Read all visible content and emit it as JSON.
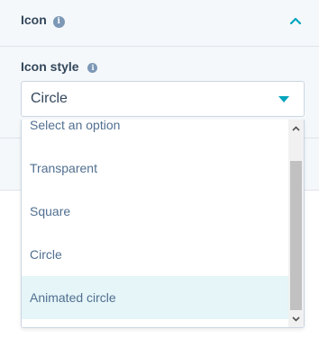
{
  "section": {
    "title": "Icon",
    "info_glyph": "i",
    "collapse_icon": "chevron-up-icon"
  },
  "field": {
    "label": "Icon style",
    "info_glyph": "i",
    "selected_value": "Circle"
  },
  "dropdown": {
    "options": [
      "Select an option",
      "Transparent",
      "Square",
      "Circle",
      "Animated circle"
    ],
    "hovered_option": "Animated circle"
  },
  "colors": {
    "accent": "#00a4bd",
    "text": "#33475b",
    "hover": "#e5f5f8"
  }
}
